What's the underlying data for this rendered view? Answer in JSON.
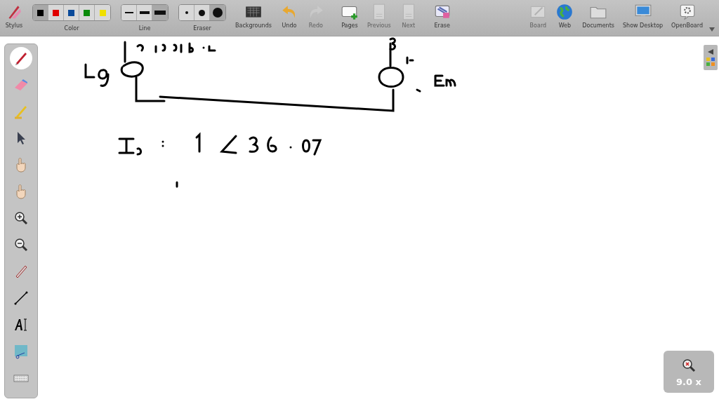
{
  "toolbar": {
    "left": [
      {
        "kind": "stylus",
        "label": "Stylus",
        "disabled": false
      },
      {
        "kind": "colors",
        "label": "Color",
        "options": [
          {
            "color": "#000000",
            "selected": true
          },
          {
            "color": "#e00000",
            "selected": false
          },
          {
            "color": "#0a4a9a",
            "selected": false
          },
          {
            "color": "#0a8a0a",
            "selected": false
          },
          {
            "color": "#f0e000",
            "selected": false
          }
        ]
      },
      {
        "kind": "lines",
        "label": "Line",
        "options": [
          {
            "selected": false
          },
          {
            "selected": false
          },
          {
            "selected": true
          }
        ]
      },
      {
        "kind": "eraser",
        "label": "Eraser",
        "options": [
          {
            "selected": false
          },
          {
            "selected": false
          },
          {
            "selected": true
          }
        ]
      },
      {
        "kind": "backgrounds",
        "label": "Backgrounds",
        "disabled": false
      },
      {
        "kind": "undo",
        "label": "Undo",
        "disabled": false
      },
      {
        "kind": "redo",
        "label": "Redo",
        "disabled": true
      },
      {
        "kind": "pages",
        "label": "Pages",
        "disabled": false
      },
      {
        "kind": "previous",
        "label": "Previous",
        "disabled": true
      },
      {
        "kind": "next",
        "label": "Next",
        "disabled": true
      },
      {
        "kind": "erase",
        "label": "Erase",
        "disabled": false
      }
    ],
    "right": [
      {
        "kind": "board",
        "label": "Board",
        "disabled": true
      },
      {
        "kind": "web",
        "label": "Web",
        "disabled": false
      },
      {
        "kind": "documents",
        "label": "Documents",
        "disabled": false
      },
      {
        "kind": "desktop",
        "label": "Show Desktop",
        "disabled": false
      },
      {
        "kind": "openboard",
        "label": "OpenBoard",
        "disabled": false
      }
    ]
  },
  "palette": [
    {
      "kind": "pen",
      "selected": true
    },
    {
      "kind": "eraser",
      "selected": false
    },
    {
      "kind": "marker",
      "selected": false
    },
    {
      "kind": "pointer",
      "selected": false
    },
    {
      "kind": "play",
      "selected": false
    },
    {
      "kind": "hand",
      "selected": false
    },
    {
      "kind": "zoom-in",
      "selected": false
    },
    {
      "kind": "zoom-out",
      "selected": false
    },
    {
      "kind": "laser",
      "selected": false
    },
    {
      "kind": "line",
      "selected": false
    },
    {
      "kind": "text",
      "selected": false
    },
    {
      "kind": "capture",
      "selected": false
    },
    {
      "kind": "keyboard",
      "selected": false
    }
  ],
  "zoom": {
    "value": "9.0 x"
  }
}
